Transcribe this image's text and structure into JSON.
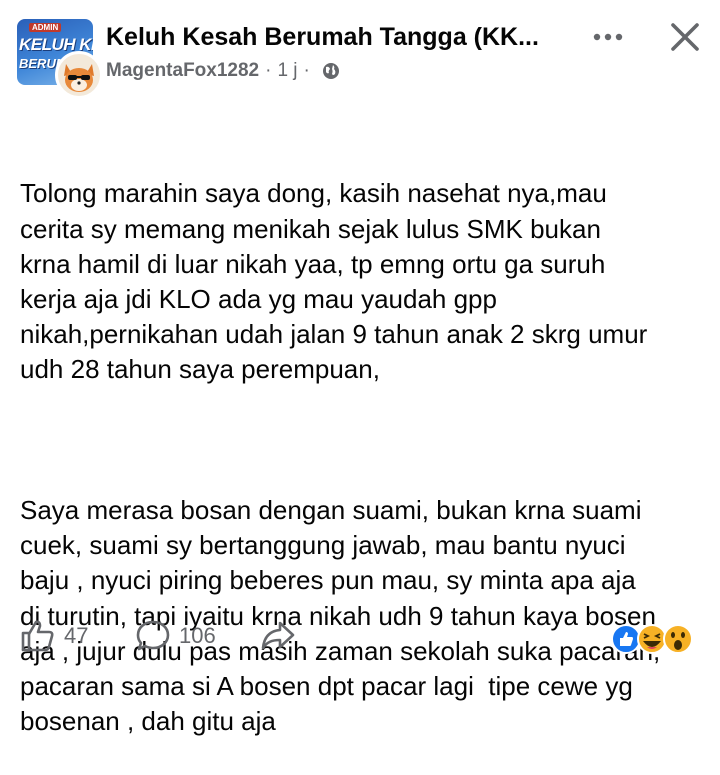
{
  "post": {
    "group_name": "Keluh Kesah Berumah Tangga (KK...",
    "group_thumb": {
      "badge": "ADMIN",
      "line1": "KELUH KESAH",
      "line2": "BERUMAH"
    },
    "author": "MagentaFox1282",
    "time": "1 j",
    "privacy_icon": "globe-icon",
    "paragraphs": [
      "Tolong marahin saya dong, kasih nasehat nya,mau\ncerita sy memang menikah sejak lulus SMK bukan\nkrna hamil di luar nikah yaa, tp emng ortu ga suruh\nkerja aja jdi KLO ada yg mau yaudah gpp\nnikah,pernikahan udah jalan 9 tahun anak 2 skrg umur\nudh 28 tahun saya perempuan,",
      "Saya merasa bosan dengan suami, bukan krna suami\ncuek, suami sy bertanggung jawab, mau bantu nyuci\nbaju , nyuci piring beberes pun mau, sy minta apa aja\ndi turutin, tapi iyaitu krna nikah udh 9 tahun kaya bosen\naja , jujur dulu pas masih zaman sekolah suka pacaran,\npacaran sama si A bosen dpt pacar lagi  tipe cewe yg\nbosenan , dah gitu aja"
    ]
  },
  "footer": {
    "like_count": "47",
    "comment_count": "106",
    "reactions": [
      "like",
      "haha",
      "wow"
    ]
  },
  "colors": {
    "text": "#050505",
    "secondary": "#65676b",
    "like_blue": "#1877f2",
    "emoji_yellow": "#f7b125"
  }
}
